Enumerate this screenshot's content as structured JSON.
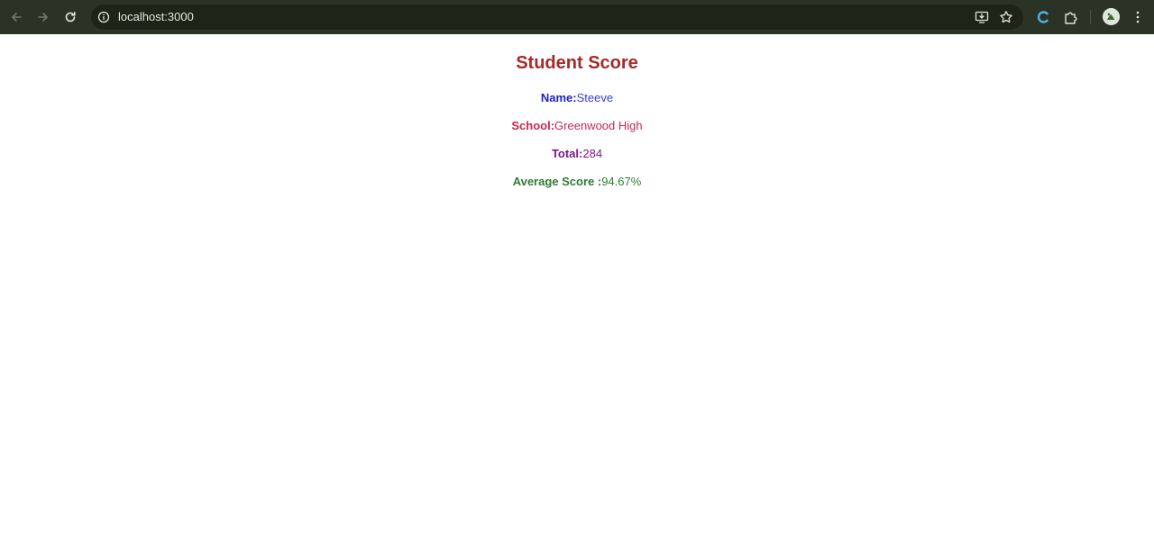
{
  "browser": {
    "url": "localhost:3000",
    "icons": {
      "back": "arrow-left-icon",
      "forward": "arrow-right-icon",
      "reload": "reload-icon",
      "site_info": "info-circle-icon",
      "install": "install-app-icon",
      "bookmark": "star-icon",
      "extension_c": "extension-c-icon",
      "extensions": "puzzle-icon",
      "profile": "avatar",
      "menu": "kebab-menu-icon"
    },
    "colors": {
      "toolbar": "#2a3325",
      "omnibox": "#1c2618"
    }
  },
  "page": {
    "title": "Student Score",
    "fields": {
      "name_label": "Name:",
      "name_value": "Steeve",
      "school_label": "School:",
      "school_value": "Greenwood High",
      "total_label": "Total:",
      "total_value": "284",
      "average_label": "Average Score :",
      "average_value": "94.67%"
    },
    "colors": {
      "title": "#a52a2a",
      "name": "#1e1ec8",
      "school": "#c8284e",
      "total": "#7d168b",
      "average": "#2e7d32"
    }
  }
}
